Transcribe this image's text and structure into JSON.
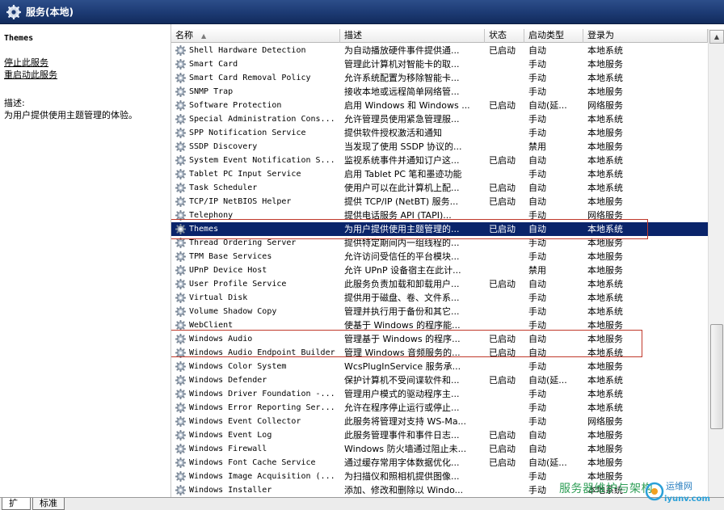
{
  "window": {
    "title": "服务(本地)"
  },
  "left_pane": {
    "selected_service": "Themes",
    "stop_link": "停止",
    "stop_suffix": "此服务",
    "restart_link": "重启动",
    "restart_suffix": "此服务",
    "description_label": "描述:",
    "description": "为用户提供使用主题管理的体验。"
  },
  "columns": [
    "名称",
    "描述",
    "状态",
    "启动类型",
    "登录为"
  ],
  "rows": [
    [
      "Shell Hardware Detection",
      "为自动播放硬件事件提供通...",
      "已启动",
      "自动",
      "本地系统"
    ],
    [
      "Smart Card",
      "管理此计算机对智能卡的取...",
      "",
      "手动",
      "本地服务"
    ],
    [
      "Smart Card Removal Policy",
      "允许系统配置为移除智能卡...",
      "",
      "手动",
      "本地系统"
    ],
    [
      "SNMP Trap",
      "接收本地或远程简单网络管...",
      "",
      "手动",
      "本地服务"
    ],
    [
      "Software Protection",
      "启用 Windows 和 Windows ...",
      "已启动",
      "自动(延...",
      "网络服务"
    ],
    [
      "Special Administration Cons...",
      "允许管理员使用紧急管理服...",
      "",
      "手动",
      "本地系统"
    ],
    [
      "SPP Notification Service",
      "提供软件授权激活和通知",
      "",
      "手动",
      "本地服务"
    ],
    [
      "SSDP Discovery",
      "当发现了使用 SSDP 协议的...",
      "",
      "禁用",
      "本地服务"
    ],
    [
      "System Event Notification S...",
      "监视系统事件并通知订户这...",
      "已启动",
      "自动",
      "本地系统"
    ],
    [
      "Tablet PC Input Service",
      "启用 Tablet PC 笔和墨迹功能",
      "",
      "手动",
      "本地系统"
    ],
    [
      "Task Scheduler",
      "使用户可以在此计算机上配...",
      "已启动",
      "自动",
      "本地系统"
    ],
    [
      "TCP/IP NetBIOS Helper",
      "提供 TCP/IP (NetBT) 服务...",
      "已启动",
      "自动",
      "本地服务"
    ],
    [
      "Telephony",
      "提供电话服务 API (TAPI)...",
      "",
      "手动",
      "网络服务"
    ],
    [
      "Themes",
      "为用户提供使用主题管理的...",
      "已启动",
      "自动",
      "本地系统"
    ],
    [
      "Thread Ordering Server",
      "提供特定期间内一组线程的...",
      "",
      "手动",
      "本地服务"
    ],
    [
      "TPM Base Services",
      "允许访问受信任的平台模块...",
      "",
      "手动",
      "本地服务"
    ],
    [
      "UPnP Device Host",
      "允许 UPnP 设备宿主在此计...",
      "",
      "禁用",
      "本地服务"
    ],
    [
      "User Profile Service",
      "此服务负责加载和卸载用户...",
      "已启动",
      "自动",
      "本地系统"
    ],
    [
      "Virtual Disk",
      "提供用于磁盘、卷、文件系...",
      "",
      "手动",
      "本地系统"
    ],
    [
      "Volume Shadow Copy",
      "管理并执行用于备份和其它...",
      "",
      "手动",
      "本地系统"
    ],
    [
      "WebClient",
      "使基于 Windows 的程序能...",
      "",
      "手动",
      "本地服务"
    ],
    [
      "Windows Audio",
      "管理基于 Windows 的程序...",
      "已启动",
      "自动",
      "本地服务"
    ],
    [
      "Windows Audio Endpoint Builder",
      "管理 Windows 音频服务的...",
      "已启动",
      "自动",
      "本地系统"
    ],
    [
      "Windows Color System",
      "WcsPlugInService 服务承...",
      "",
      "手动",
      "本地服务"
    ],
    [
      "Windows Defender",
      "保护计算机不受间谍软件和...",
      "已启动",
      "自动(延...",
      "本地系统"
    ],
    [
      "Windows Driver Foundation -...",
      "管理用户模式的驱动程序主...",
      "",
      "手动",
      "本地系统"
    ],
    [
      "Windows Error Reporting Ser...",
      "允许在程序停止运行或停止...",
      "",
      "手动",
      "本地系统"
    ],
    [
      "Windows Event Collector",
      "此服务将管理对支持 WS-Ma...",
      "",
      "手动",
      "网络服务"
    ],
    [
      "Windows Event Log",
      "此服务管理事件和事件日志...",
      "已启动",
      "自动",
      "本地服务"
    ],
    [
      "Windows Firewall",
      "Windows 防火墙通过阻止未...",
      "已启动",
      "自动",
      "本地服务"
    ],
    [
      "Windows Font Cache Service",
      "通过缓存常用字体数据优化...",
      "已启动",
      "自动(延...",
      "本地服务"
    ],
    [
      "Windows Image Acquisition (...",
      "为扫描仪和照相机提供图像...",
      "",
      "手动",
      "本地服务"
    ],
    [
      "Windows Installer",
      "添加、修改和删除以 Windo...",
      "",
      "手动",
      "本地系统"
    ]
  ],
  "selected_row_index": 13,
  "tabs": [
    "扩展",
    "标准"
  ],
  "watermark": {
    "text": "服务器维护与架构",
    "logo_text": "运维网",
    "site": "iyunv.com"
  },
  "colors": {
    "selection": "#0a246a",
    "highlight_box": "#c0392b",
    "titlebar": "#1c3a73",
    "watermark": "#2e9e56"
  }
}
